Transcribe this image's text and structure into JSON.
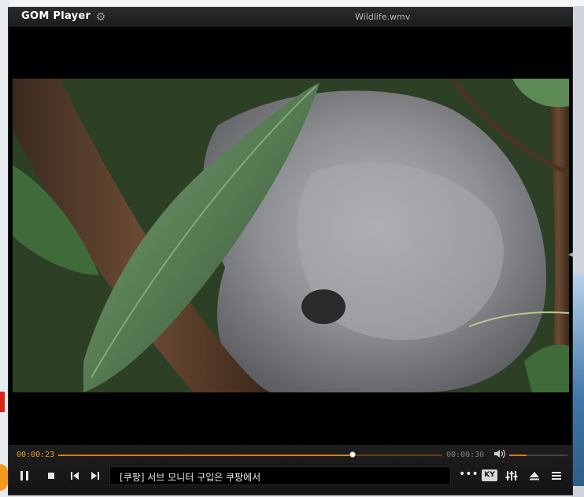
{
  "app": {
    "logo_text": "GOM Player",
    "file_title": "Wildlife.wmv"
  },
  "playback": {
    "elapsed": "00:00:23",
    "total": "00:00:30",
    "progress_fraction": 0.766,
    "volume_fraction": 0.3
  },
  "ad_banner": {
    "text": "[쿠팡] 서브 모니터 구입은 쿠팡에서"
  },
  "controls": {
    "more_label": "•••",
    "subtitle_label": "KY"
  },
  "icons": {
    "settings": "gear-icon",
    "pause": "pause-icon",
    "stop": "stop-icon",
    "prev": "previous-icon",
    "next": "next-icon",
    "volume": "speaker-icon",
    "equalizer": "equalizer-icon",
    "eject": "eject-icon",
    "menu": "hamburger-icon"
  },
  "colors": {
    "accent": "#d97a1f",
    "background": "#070707"
  }
}
